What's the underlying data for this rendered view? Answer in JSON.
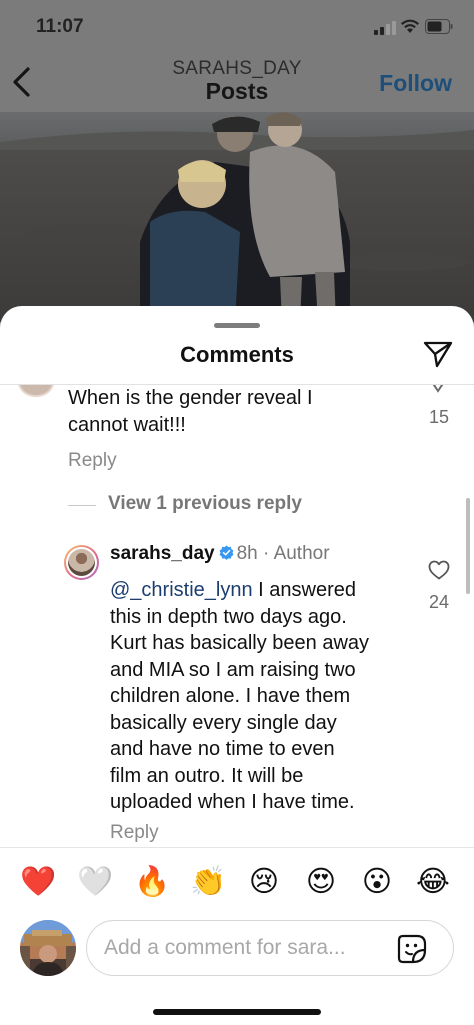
{
  "status_bar": {
    "time": "11:07"
  },
  "nav": {
    "username": "SARAHS_DAY",
    "title": "Posts",
    "follow_label": "Follow"
  },
  "sheet": {
    "title": "Comments"
  },
  "parent_comment": {
    "text_line1": "When is the gender reveal I",
    "text_line2": "cannot wait!!!",
    "likes": "15",
    "reply_label": "Reply"
  },
  "view_previous_label": "View 1 previous reply",
  "reply_comment": {
    "username": "sarahs_day",
    "time": "8h",
    "separator": "·",
    "author_label": "Author",
    "mention": "@_christie_lynn",
    "lines": [
      " I answered",
      "this in depth two days ago.",
      "Kurt has basically been away",
      "and MIA so I am raising two",
      "children alone. I have them",
      "basically every single day",
      "and have no time to even",
      "film an outro. It will be",
      "uploaded when I have time."
    ],
    "likes": "24",
    "reply_label": "Reply"
  },
  "reactions": [
    "❤️",
    "🤍",
    "🔥",
    "👏",
    "😢",
    "😍",
    "😮",
    "😂"
  ],
  "composer": {
    "placeholder": "Add a comment for sara..."
  },
  "colors": {
    "mention": "#1d3d70",
    "follow": "#1d4f7a",
    "verified": "#3897f0"
  }
}
